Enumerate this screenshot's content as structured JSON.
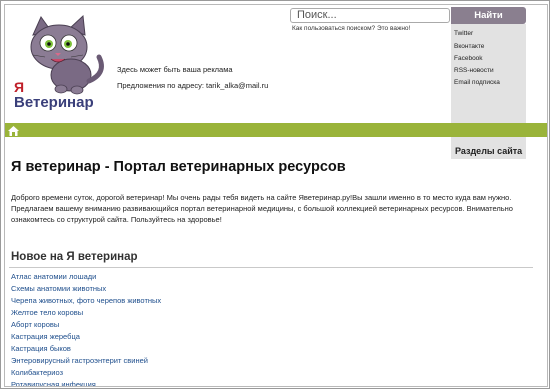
{
  "header": {
    "logo_text_ya": "Я",
    "logo_text_name": "Ветеринар",
    "ad_text": "Здесь может быть ваша реклама",
    "ad_contact": "Предложения по адресу: tarik_alka@mail.ru"
  },
  "search": {
    "placeholder": "Поиск...",
    "button_label": "Найти",
    "help_text": "Как пользоваться поиском? Это важно!"
  },
  "social_links": [
    "Twitter",
    "Вконтакте",
    "Facebook",
    "RSS-новости",
    "Email подписка"
  ],
  "sidebar": {
    "sections_label": "Разделы сайта"
  },
  "main": {
    "title": "Я ветеринар - Портал ветеринарных ресурсов",
    "intro": "Доброго времени суток, дорогой ветеринар! Мы очень рады тебя видеть на сайте Яветеринар.ру!Вы зашли именно в то место куда вам нужно. Предлагаем вашему вниманию развивающийся портал ветеринарной медицины, с большой коллекцией ветеринарных ресурсов. Внимательно ознакомтесь со структурой сайта. Пользуйтесь на здоровье!",
    "new_section_title": "Новое на Я ветеринар",
    "new_items": [
      "Атлас анатомии лошади",
      "Схемы анатомии животных",
      "Черепа животных, фото черепов животных",
      "Желтое тело коровы",
      "Аборт коровы",
      "Кастрация жеребца",
      "Кастрация быков",
      "Энтеровирусный гастроэнтерит свиней",
      "Колибактериоз",
      "Ротавирусная инфекция"
    ]
  },
  "colors": {
    "nav_green": "#9ab43a",
    "search_button": "#8a7f8f",
    "link_blue": "#1e4e8c",
    "panel_gray": "#e2e2e2"
  }
}
